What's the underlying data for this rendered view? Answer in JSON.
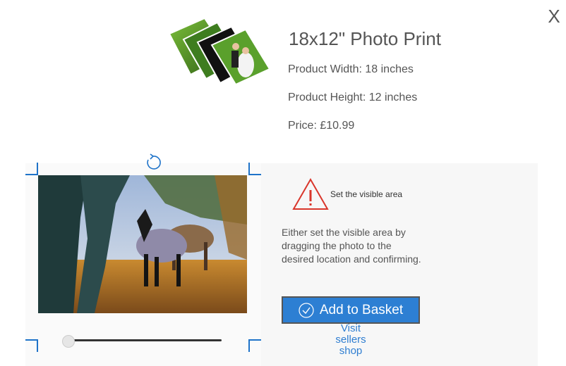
{
  "close": {
    "label": "X"
  },
  "product": {
    "title": "18x12\" Photo Print",
    "width": "Product Width: 18 inches",
    "height": "Product Height: 12 inches",
    "price": "Price: £10.99"
  },
  "editor": {
    "warning": "Set the visible area",
    "instructions": "Either set the visible area by dragging the photo to the desired location and confirming.",
    "zoom_level": 0
  },
  "actions": {
    "add_to_basket": "Add to Basket",
    "visit_shop": "Visit sellers shop"
  },
  "colors": {
    "accent": "#2d7fd3",
    "link": "#2f7ed1",
    "warning": "#d9362b",
    "crop_marks": "#1f73c9"
  }
}
